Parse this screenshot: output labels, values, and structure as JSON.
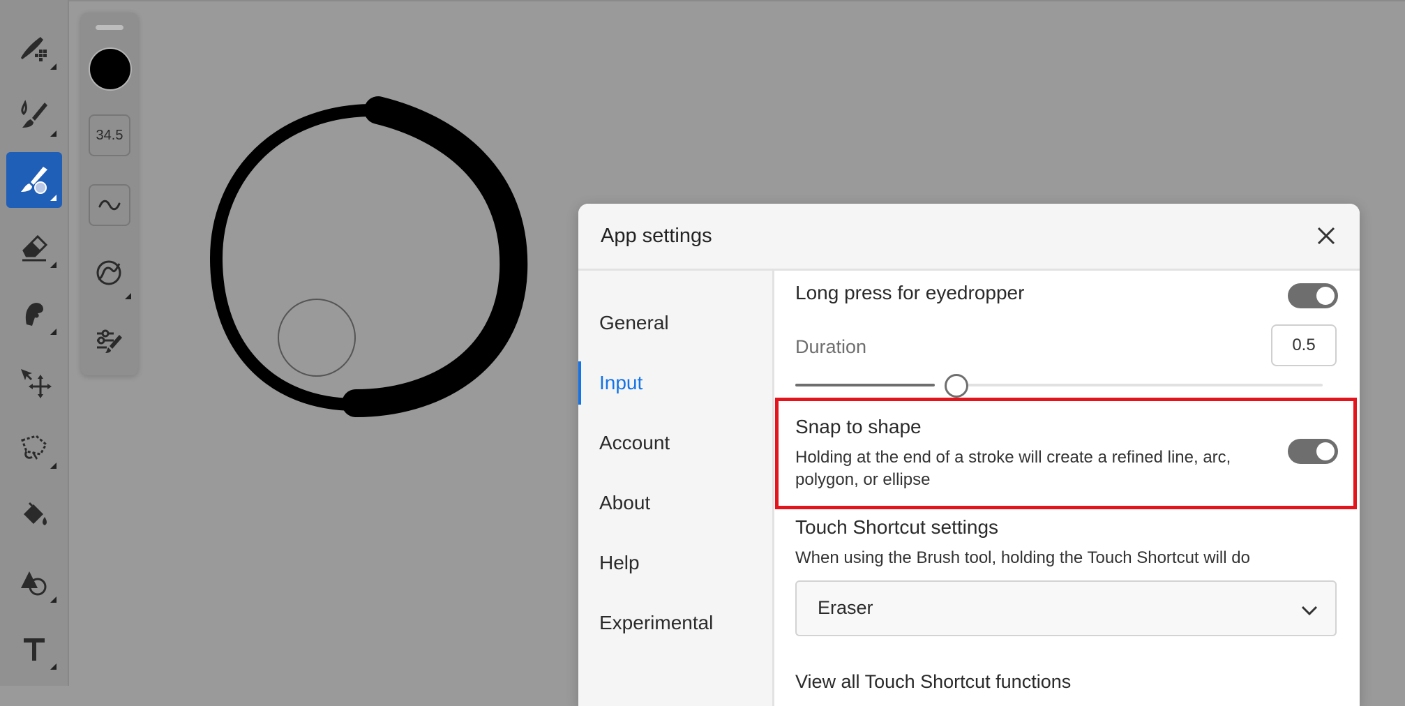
{
  "toolbar": {
    "tools": [
      {
        "name": "pixel-brush",
        "active": false
      },
      {
        "name": "live-brush",
        "active": false
      },
      {
        "name": "vector-brush",
        "active": true
      },
      {
        "name": "eraser",
        "active": false
      },
      {
        "name": "smudge",
        "active": false
      },
      {
        "name": "transform",
        "active": false
      },
      {
        "name": "lasso",
        "active": false
      },
      {
        "name": "fill",
        "active": false
      },
      {
        "name": "shapes",
        "active": false
      },
      {
        "name": "text",
        "active": false
      }
    ]
  },
  "brush_panel": {
    "color": "#000000",
    "size_value": "34.5"
  },
  "dialog": {
    "title": "App settings",
    "nav": [
      {
        "label": "General",
        "active": false
      },
      {
        "label": "Input",
        "active": true
      },
      {
        "label": "Account",
        "active": false
      },
      {
        "label": "About",
        "active": false
      },
      {
        "label": "Help",
        "active": false
      },
      {
        "label": "Experimental",
        "active": false
      }
    ],
    "content": {
      "eyedropper_label": "Long press for eyedropper",
      "eyedropper_on": true,
      "duration_label": "Duration",
      "duration_value": "0.5",
      "duration_fraction": 0.3,
      "snap_label": "Snap to shape",
      "snap_desc_line1": "Holding at the end of a stroke will create a refined line, arc,",
      "snap_desc_line2": "polygon, or ellipse",
      "snap_on": true,
      "touch_title": "Touch Shortcut settings",
      "touch_desc": "When using the Brush tool, holding the Touch Shortcut will do",
      "touch_select_value": "Eraser",
      "view_all_link": "View all Touch Shortcut functions"
    }
  },
  "colors": {
    "accent": "#1473e6",
    "highlight": "#e3141b",
    "toggle_on": "#6e6e6e"
  }
}
